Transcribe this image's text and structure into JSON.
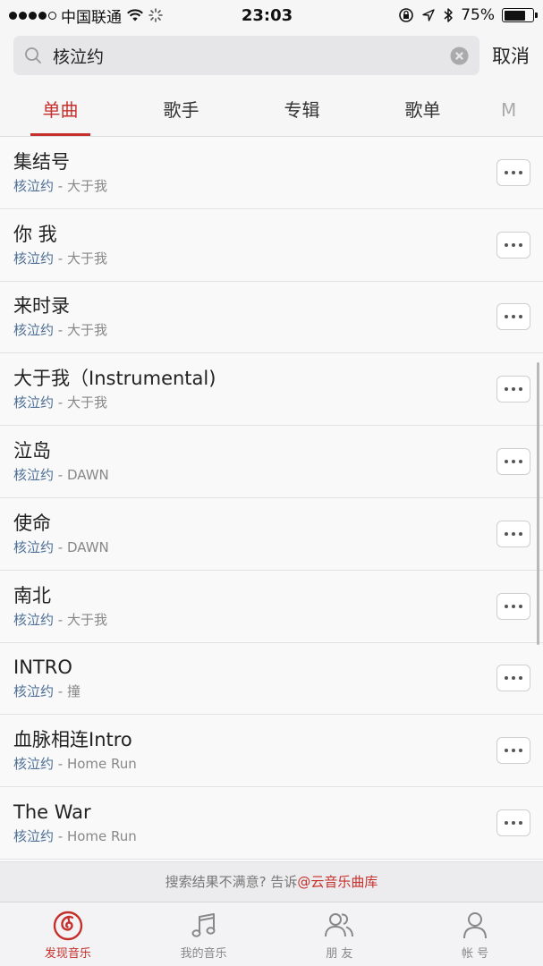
{
  "status_bar": {
    "carrier": "中国联通",
    "time": "23:03",
    "battery": "75%",
    "battery_level": 0.75
  },
  "search": {
    "query": "核泣约",
    "cancel_label": "取消"
  },
  "tabs": [
    {
      "label": "单曲",
      "active": true
    },
    {
      "label": "歌手",
      "active": false
    },
    {
      "label": "专辑",
      "active": false
    },
    {
      "label": "歌单",
      "active": false
    },
    {
      "label": "M",
      "active": false
    }
  ],
  "songs": [
    {
      "title": "集结号",
      "artist": "核泣约",
      "album": " - 大于我"
    },
    {
      "title": "你 我",
      "artist": "核泣约",
      "album": " - 大于我"
    },
    {
      "title": "来时录",
      "artist": "核泣约",
      "album": " - 大于我"
    },
    {
      "title": "大于我（Instrumental)",
      "artist": "核泣约",
      "album": " - 大于我"
    },
    {
      "title": "泣岛",
      "artist": "核泣约",
      "album": " - DAWN"
    },
    {
      "title": "使命",
      "artist": "核泣约",
      "album": " - DAWN"
    },
    {
      "title": "南北",
      "artist": "核泣约",
      "album": " - 大于我"
    },
    {
      "title": "INTRO",
      "artist": "核泣约",
      "album": " - 撞"
    },
    {
      "title": "血脉相连Intro",
      "artist": "核泣约",
      "album": " - Home Run"
    },
    {
      "title": "The War",
      "artist": "核泣约",
      "album": " - Home Run"
    }
  ],
  "feedback": {
    "text": "搜索结果不满意? 告诉",
    "link": "@云音乐曲库"
  },
  "tab_bar": [
    {
      "label": "发现音乐",
      "icon": "netease-music-icon",
      "active": true
    },
    {
      "label": "我的音乐",
      "icon": "music-note-icon",
      "active": false
    },
    {
      "label": "朋 友",
      "icon": "friends-icon",
      "active": false
    },
    {
      "label": "帐 号",
      "icon": "account-icon",
      "active": false
    }
  ],
  "colors": {
    "accent": "#c6302c",
    "artist": "#4d6f95"
  }
}
